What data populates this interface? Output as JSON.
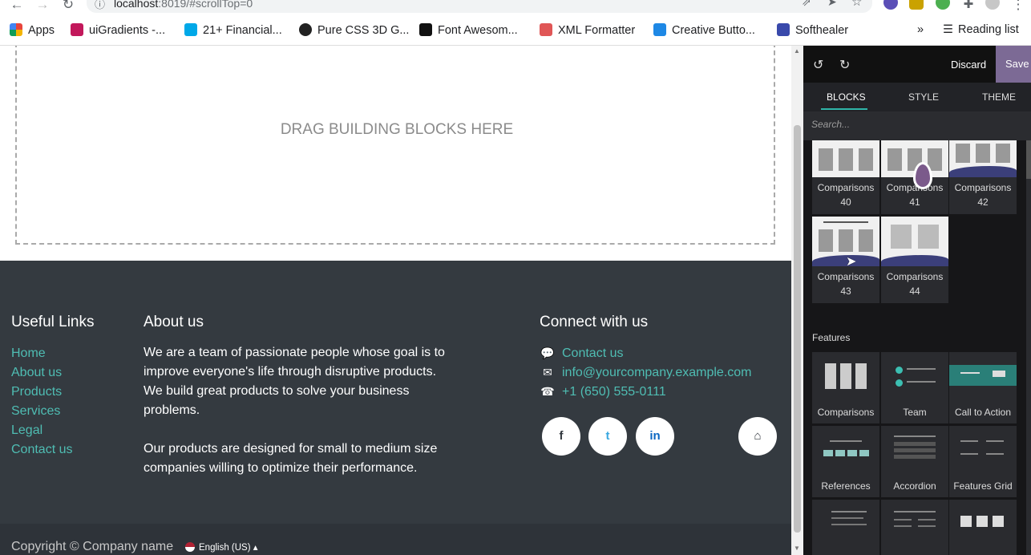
{
  "browser": {
    "url_host": "localhost",
    "url_rest": ":8019/#scrollTop=0",
    "bookmarks": [
      {
        "label": "Apps",
        "color": "#e8453c"
      },
      {
        "label": "uiGradients -...",
        "color": "#c2185b"
      },
      {
        "label": "21+ Financial...",
        "color": "#00a8e8"
      },
      {
        "label": "Pure CSS 3D G...",
        "color": "#222222"
      },
      {
        "label": "Font Awesom...",
        "color": "#111111"
      },
      {
        "label": "XML Formatter",
        "color": "#e05656"
      },
      {
        "label": "Creative Butto...",
        "color": "#1e88e5"
      },
      {
        "label": "Softhealer",
        "color": "#3949ab"
      }
    ],
    "more": "»",
    "reading_list": "Reading list"
  },
  "canvas": {
    "drop_text": "DRAG BUILDING BLOCKS HERE"
  },
  "footer": {
    "useful_links_title": "Useful Links",
    "useful_links": [
      "Home",
      "About us",
      "Products",
      "Services",
      "Legal",
      "Contact us"
    ],
    "about_title": "About us",
    "about_lines": [
      "We are a team of passionate people whose goal is to",
      "improve everyone's life through disruptive products.",
      "We build great products to solve your business",
      "problems."
    ],
    "about_lines_2": [
      "Our products are designed for small to medium size",
      "companies willing to optimize their performance."
    ],
    "connect_title": "Connect with us",
    "contact_label": "Contact us",
    "email": "info@yourcompany.example.com",
    "phone": "+1 (650) 555-0111",
    "social": [
      "f",
      "t",
      "in",
      "⌂"
    ],
    "copyright": "Copyright © Company name",
    "language": "English (US)"
  },
  "panel": {
    "discard_label": "Discard",
    "save_label": "Save",
    "tabs": [
      "BLOCKS",
      "STYLE",
      "THEME"
    ],
    "search_placeholder": "Search...",
    "comparison_blocks": [
      {
        "line1": "Comparisons",
        "line2": "40"
      },
      {
        "line1": "Comparisons",
        "line2": "41"
      },
      {
        "line1": "Comparisons",
        "line2": "42"
      },
      {
        "line1": "Comparisons",
        "line2": "43"
      },
      {
        "line1": "Comparisons",
        "line2": "44"
      }
    ],
    "features_title": "Features",
    "feature_blocks": [
      "Comparisons",
      "Team",
      "Call to Action",
      "References",
      "Accordion",
      "Features Grid"
    ]
  },
  "colors": {
    "accent": "#2fb5a8",
    "save": "#7c6a95",
    "footer_bg": "#343a40",
    "link": "#4fbdb3"
  }
}
